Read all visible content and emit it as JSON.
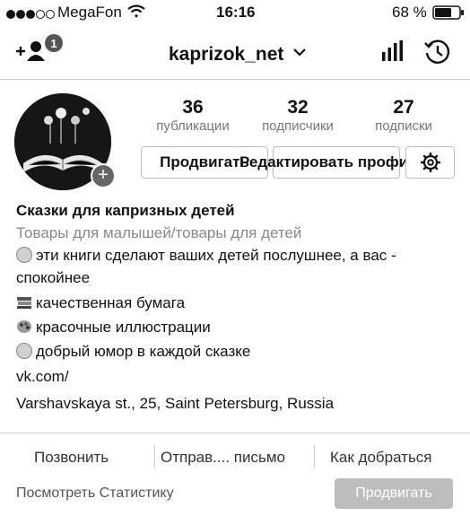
{
  "status_bar": {
    "carrier": "MegaFon",
    "time": "16:16",
    "battery": "68 %"
  },
  "nav": {
    "username": "kaprizok_net",
    "add_user_badge": "1"
  },
  "profile": {
    "stats": [
      {
        "value": "36",
        "label": "публикации"
      },
      {
        "value": "32",
        "label": "подписчики"
      },
      {
        "value": "27",
        "label": "подписки"
      }
    ],
    "promote_button": "Продвигать",
    "edit_profile_button": "Редактировать профиль",
    "name": "Сказки для капризных детей",
    "category": "Товары для малышей/товары для детей",
    "bio_lines": [
      "эти книги сделают ваших детей послушнее, а вас -",
      "спокойнее",
      "качественная бумага",
      "красочные иллюстрации",
      "добрый юмор в каждой сказке"
    ],
    "link": "vk.com/",
    "address": "Varshavskaya st., 25, Saint Petersburg, Russia"
  },
  "actions": {
    "call": "Позвонить",
    "email": "Отправ.... письмо",
    "directions": "Как добраться",
    "view_stats": "Посмотреть Статистику",
    "promote": "Продвигать"
  }
}
